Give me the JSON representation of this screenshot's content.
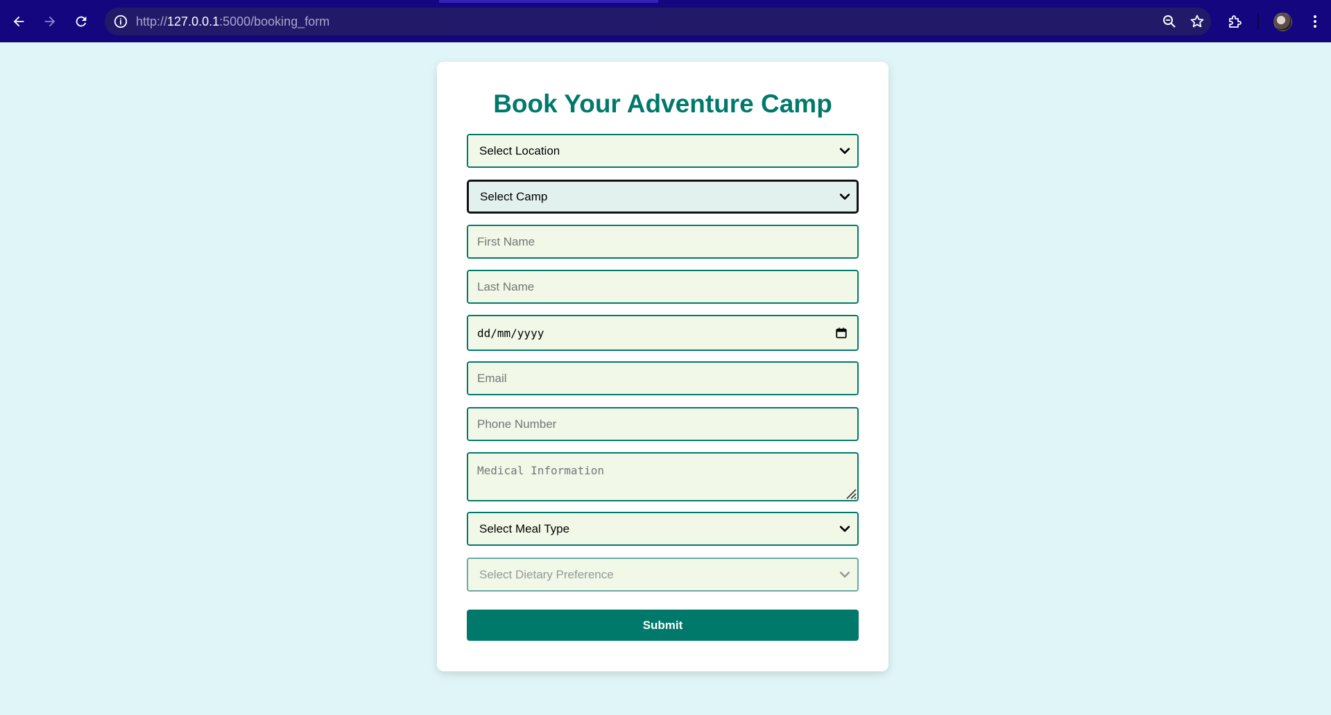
{
  "browser": {
    "url_scheme": "http://",
    "url_host": "127.0.0.1",
    "url_path": ":5000/booking_form"
  },
  "form": {
    "title": "Book Your Adventure Camp",
    "location_select": "Select Location",
    "camp_select": "Select Camp",
    "first_name_placeholder": "First Name",
    "last_name_placeholder": "Last Name",
    "date_placeholder": "dd/mm/yyyy",
    "email_placeholder": "Email",
    "phone_placeholder": "Phone Number",
    "medical_placeholder": "Medical Information",
    "meal_select": "Select Meal Type",
    "dietary_select": "Select Dietary Preference",
    "submit_label": "Submit"
  },
  "colors": {
    "page_background": "#dff5f7",
    "browser_bar": "#14067e",
    "accent_teal": "#00796b",
    "field_background": "#f1f8e8"
  }
}
